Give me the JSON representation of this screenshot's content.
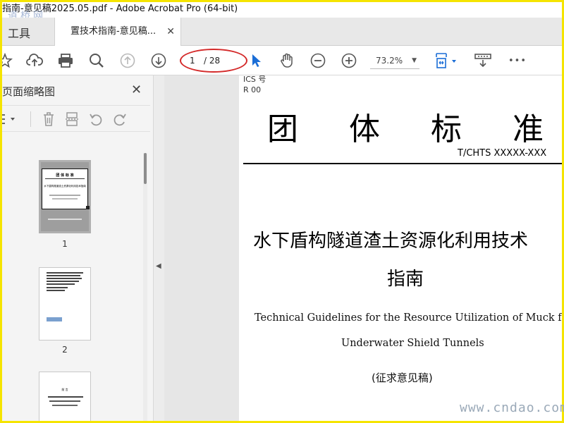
{
  "window": {
    "title": "指南-意见稿2025.05.pdf - Adobe Acrobat Pro (64-bit)"
  },
  "watermark": {
    "top": "道桥网",
    "bottom": "www.cndao.com"
  },
  "tabs": {
    "tools_label": "工具",
    "document_label": "置技术指南-意见稿...",
    "close_glyph": "✕"
  },
  "toolbar": {
    "page_current": "1",
    "page_total": "/ 28",
    "zoom_value": "73.2%",
    "more_glyph": "•••"
  },
  "left_panel": {
    "title": "页面缩略图",
    "close_glyph": "✕",
    "thumbnails": [
      {
        "number": "1",
        "selected": true
      },
      {
        "number": "2",
        "selected": false
      },
      {
        "number": "",
        "selected": false
      }
    ],
    "thumb1_heading": "团 体 标 准",
    "thumb1_subtitle": "水下盾构隧道渣土资源化利用技术指南",
    "thumb3_heading": "前 言"
  },
  "document": {
    "ics": "ICS 号",
    "r00": "R  00",
    "main_title": "团体标准",
    "standard_number": "T/CHTS  XXXXX-XXX",
    "cn_title_line1": "水下盾构隧道渣土资源化利用技术",
    "cn_title_line2": "指南",
    "en_title_line1": "Technical Guidelines for the Resource Utilization of Muck from",
    "en_title_line2": "Underwater Shield Tunnels",
    "draft_note": "(征求意见稿)"
  },
  "colors": {
    "frame": "#f5e400",
    "select_blue": "#1a6dd6",
    "annotation_red": "#d42a2a"
  }
}
